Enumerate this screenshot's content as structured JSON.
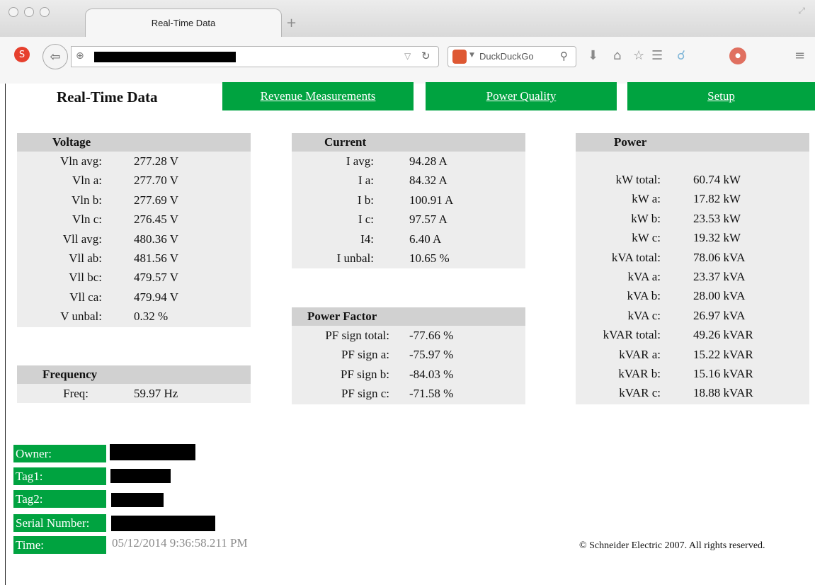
{
  "browser": {
    "tab_title": "Real-Time Data",
    "new_tab_symbol": "+",
    "search_engine": "DuckDuckGo",
    "search_icon": "magnifier-icon"
  },
  "nav": {
    "title": "Real-Time Data",
    "buttons": [
      "Revenue Measurements",
      "Power Quality",
      "Setup"
    ],
    "accent_color": "#00a340"
  },
  "voltage": {
    "title": "Voltage",
    "rows": [
      {
        "label": "Vln avg:",
        "value": "277.28 V"
      },
      {
        "label": "Vln a:",
        "value": "277.70 V"
      },
      {
        "label": "Vln b:",
        "value": "277.69 V"
      },
      {
        "label": "Vln c:",
        "value": "276.45 V"
      },
      {
        "label": "Vll avg:",
        "value": "480.36 V"
      },
      {
        "label": "Vll ab:",
        "value": "481.56 V"
      },
      {
        "label": "Vll bc:",
        "value": "479.57 V"
      },
      {
        "label": "Vll ca:",
        "value": "479.94 V"
      },
      {
        "label": "V unbal:",
        "value": "0.32 %"
      }
    ]
  },
  "frequency": {
    "title": "Frequency",
    "rows": [
      {
        "label": "Freq:",
        "value": "59.97 Hz"
      }
    ]
  },
  "current": {
    "title": "Current",
    "rows": [
      {
        "label": "I avg:",
        "value": "94.28 A"
      },
      {
        "label": "I a:",
        "value": "84.32 A"
      },
      {
        "label": "I b:",
        "value": "100.91 A"
      },
      {
        "label": "I c:",
        "value": "97.57 A"
      },
      {
        "label": "I4:",
        "value": "6.40 A"
      },
      {
        "label": "I unbal:",
        "value": "10.65 %"
      }
    ]
  },
  "power_factor": {
    "title": "Power Factor",
    "rows": [
      {
        "label": "PF sign total:",
        "value": "-77.66 %"
      },
      {
        "label": "PF sign a:",
        "value": "-75.97 %"
      },
      {
        "label": "PF sign b:",
        "value": "-84.03 %"
      },
      {
        "label": "PF sign c:",
        "value": "-71.58 %"
      }
    ]
  },
  "power": {
    "title": "Power",
    "rows": [
      {
        "label": "kW total:",
        "value": "60.74 kW"
      },
      {
        "label": "kW a:",
        "value": "17.82 kW"
      },
      {
        "label": "kW b:",
        "value": "23.53 kW"
      },
      {
        "label": "kW c:",
        "value": "19.32 kW"
      },
      {
        "label": "kVA total:",
        "value": "78.06 kVA"
      },
      {
        "label": "kVA a:",
        "value": "23.37 kVA"
      },
      {
        "label": "kVA b:",
        "value": "28.00 kVA"
      },
      {
        "label": "kVA c:",
        "value": "26.97 kVA"
      },
      {
        "label": "kVAR total:",
        "value": "49.26 kVAR"
      },
      {
        "label": "kVAR a:",
        "value": "15.22 kVAR"
      },
      {
        "label": "kVAR b:",
        "value": "15.16 kVAR"
      },
      {
        "label": "kVAR c:",
        "value": "18.88 kVAR"
      }
    ]
  },
  "info": {
    "owner_label": "Owner:",
    "tag1_label": "Tag1:",
    "tag2_label": "Tag2:",
    "serial_label": "Serial Number:",
    "time_label": "Time:",
    "time_value": "05/12/2014 9:36:58.211 PM"
  },
  "footer": {
    "copyright": "© Schneider Electric 2007. All rights reserved."
  }
}
